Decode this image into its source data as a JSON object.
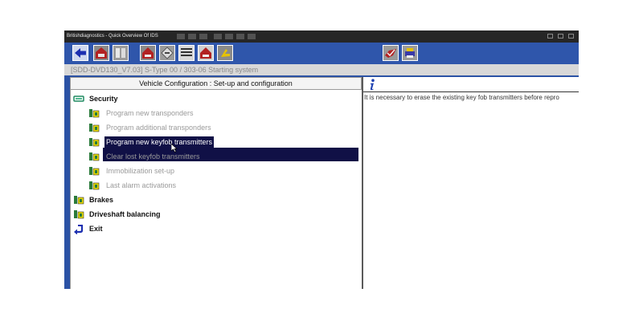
{
  "window": {
    "title": "Britishdiagnostics - Quick Overview Of IDS",
    "taskbar_label": "",
    "system_text": ""
  },
  "status_bar": {
    "text": "[SDD-DVD130_V7.03]   S-Type 00 / 303-06 Starting system"
  },
  "toolbar": {
    "left_buttons": [
      {
        "icon": "back-arrow-icon"
      },
      {
        "icon": "vehicle-garage-icon"
      },
      {
        "icon": "tool-panel-icon"
      },
      {
        "icon": "vehicle-icon"
      },
      {
        "icon": "diagnostic-tag-icon"
      },
      {
        "icon": "configuration-icon"
      },
      {
        "icon": "vehicle-selected-icon"
      },
      {
        "icon": "forward-arrow-icon"
      }
    ],
    "right_buttons": [
      {
        "icon": "tick-vehicle-icon"
      },
      {
        "icon": "printer-icon"
      }
    ]
  },
  "left_panel": {
    "header": "Vehicle Configuration : Set-up and configuration",
    "items": [
      {
        "label": "Security",
        "type": "category",
        "icon": "expanded-folder-icon"
      },
      {
        "label": "Program new transponders",
        "type": "sub",
        "icon": "transponder-icon"
      },
      {
        "label": "Program additional transponders",
        "type": "sub",
        "icon": "transponder-icon"
      },
      {
        "label": "Program new keyfob transmitters",
        "type": "sub",
        "icon": "transponder-icon",
        "selected": true
      },
      {
        "label": "Clear lost keyfob transmitters",
        "type": "sub",
        "icon": "transponder-icon"
      },
      {
        "label": "Immobilization set-up",
        "type": "sub",
        "icon": "transponder-icon"
      },
      {
        "label": "Last alarm activations",
        "type": "sub",
        "icon": "transponder-icon"
      },
      {
        "label": "Brakes",
        "type": "category",
        "icon": "transponder-icon"
      },
      {
        "label": "Driveshaft balancing",
        "type": "category",
        "icon": "transponder-icon"
      },
      {
        "label": "Exit",
        "type": "category",
        "icon": "exit-arrow-icon"
      }
    ]
  },
  "right_panel": {
    "icon": "info-icon",
    "text": "It is necessary to erase the existing key fob transmitters before repro"
  },
  "colors": {
    "app_blue": "#2b52a5",
    "selection": "#101046",
    "toolbar_border": "#ffffff",
    "disabled_text": "#9a9a9a"
  }
}
